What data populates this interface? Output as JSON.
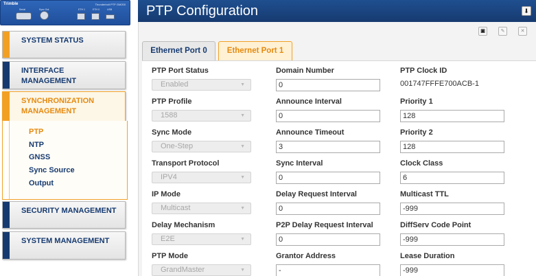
{
  "device": {
    "brand": "Trimble",
    "model": "Thunderbolt PTP GM200",
    "port_labels": [
      "Serial",
      "Sync Out",
      "ETH 1",
      "ETH 0",
      "USB"
    ]
  },
  "nav": {
    "system_status": "SYSTEM STATUS",
    "interface_management": "INTERFACE MANAGEMENT",
    "synchronization_management": "SYNCHRONIZATION MANAGEMENT",
    "sync_submenu": [
      "PTP",
      "NTP",
      "GNSS",
      "Sync Source",
      "Output"
    ],
    "security_management": "SECURITY MANAGEMENT",
    "system_management": "SYSTEM MANAGEMENT"
  },
  "header": {
    "title": "PTP Configuration"
  },
  "tabs": [
    "Ethernet Port 0",
    "Ethernet Port 1"
  ],
  "form": {
    "col1": [
      {
        "label": "PTP Port Status",
        "value": "Enabled"
      },
      {
        "label": "PTP Profile",
        "value": "1588"
      },
      {
        "label": "Sync Mode",
        "value": "One-Step"
      },
      {
        "label": "Transport Protocol",
        "value": "IPV4"
      },
      {
        "label": "IP Mode",
        "value": "Multicast"
      },
      {
        "label": "Delay Mechanism",
        "value": "E2E"
      },
      {
        "label": "PTP Mode",
        "value": "GrandMaster"
      }
    ],
    "col2": [
      {
        "label": "Domain Number",
        "value": "0"
      },
      {
        "label": "Announce Interval",
        "value": "0"
      },
      {
        "label": "Announce Timeout",
        "value": "3"
      },
      {
        "label": "Sync Interval",
        "value": "0"
      },
      {
        "label": "Delay Request Interval",
        "value": "0"
      },
      {
        "label": "P2P Delay Request Interval",
        "value": "0"
      },
      {
        "label": "Grantor Address",
        "value": "-"
      }
    ],
    "col3": [
      {
        "label": "PTP Clock ID",
        "value": "001747FFFE700ACB-1"
      },
      {
        "label": "Priority 1",
        "value": "128"
      },
      {
        "label": "Priority 2",
        "value": "128"
      },
      {
        "label": "Clock Class",
        "value": "6"
      },
      {
        "label": "Multicast TTL",
        "value": "-999"
      },
      {
        "label": "DiffServ Code Point",
        "value": "-999"
      },
      {
        "label": "Lease Duration",
        "value": "-999"
      }
    ]
  },
  "colors": {
    "navy": "#163a70",
    "orange": "#f2a024",
    "active_text": "#e58a10"
  }
}
